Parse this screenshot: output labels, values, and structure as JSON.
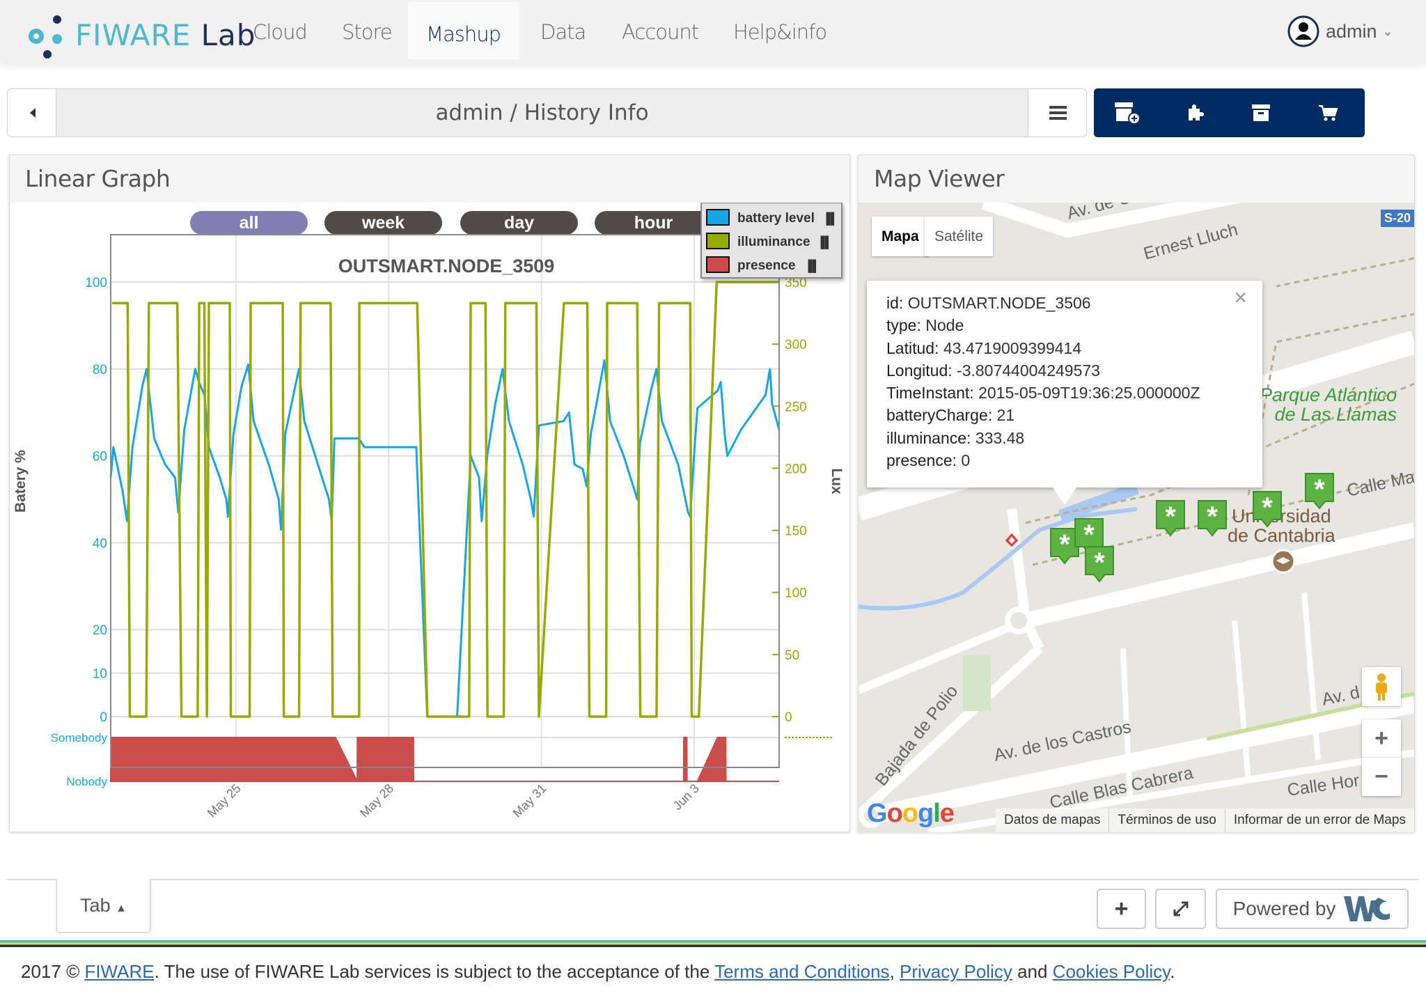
{
  "header": {
    "logo_text_1": "FIWARE",
    "logo_text_2": "Lab",
    "nav": [
      {
        "label": "Cloud"
      },
      {
        "label": "Store"
      },
      {
        "label": "Mashup",
        "active": true
      },
      {
        "label": "Data"
      },
      {
        "label": "Account"
      },
      {
        "label": "Help&info"
      }
    ],
    "user": "admin"
  },
  "breadcrumb": {
    "text": "admin / History Info"
  },
  "toolbar": {
    "icons": [
      "add-workspace-icon",
      "puzzle-icon",
      "archive-icon",
      "cart-icon"
    ],
    "color": "#002a62"
  },
  "graph_panel": {
    "title": "Linear Graph",
    "ranges": [
      {
        "label": "all",
        "selected": true
      },
      {
        "label": "week"
      },
      {
        "label": "day"
      },
      {
        "label": "hour"
      }
    ]
  },
  "chart_data": {
    "type": "line",
    "title": "OUTSMART.NODE_3509",
    "xlabel": "",
    "x_range": [
      "May 22 13:00",
      "Jun 4 16:00"
    ],
    "x_ticks": [
      "May 25",
      "May 28",
      "May 31",
      "Jun 3"
    ],
    "y_left": {
      "label": "Batery %",
      "range": [
        0,
        100
      ],
      "ticks": [
        0,
        10,
        20,
        40,
        60,
        80,
        100
      ]
    },
    "y_right": {
      "label": "Lux",
      "range": [
        0,
        350
      ],
      "ticks": [
        0,
        50,
        100,
        150,
        200,
        250,
        300,
        350
      ]
    },
    "presence_axis": {
      "ticks": [
        "Somebody",
        "Nobody"
      ]
    },
    "grid": true,
    "legend": "top-right",
    "series": [
      {
        "name": "battery level",
        "color": "#18a5e6",
        "axis": "left",
        "points": [
          [
            "May 22 13:00",
            55
          ],
          [
            "May 22 14:15",
            62
          ],
          [
            "May 22 18:35",
            52
          ],
          [
            "May 22 20:40",
            45
          ],
          [
            "May 22 23:15",
            62
          ],
          [
            "May 23 03:55",
            76
          ],
          [
            "May 23 05:55",
            80
          ],
          [
            "May 23 09:30",
            64
          ],
          [
            "May 23 14:40",
            58
          ],
          [
            "May 23 19:20",
            55
          ],
          [
            "May 23 20:50",
            47
          ],
          [
            "May 23 23:40",
            66
          ],
          [
            "May 24 04:50",
            80
          ],
          [
            "May 24 06:35",
            77
          ],
          [
            "May 24 09:10",
            74
          ],
          [
            "May 24 11:15",
            62
          ],
          [
            "May 24 16:25",
            55
          ],
          [
            "May 24 19:30",
            50
          ],
          [
            "May 24 20:15",
            46
          ],
          [
            "May 24 22:50",
            65
          ],
          [
            "May 25 02:40",
            76
          ],
          [
            "May 25 05:50",
            81
          ],
          [
            "May 25 08:20",
            68
          ],
          [
            "May 25 15:30",
            58
          ],
          [
            "May 25 20:10",
            50
          ],
          [
            "May 25 21:15",
            43
          ],
          [
            "May 25 23:15",
            65
          ],
          [
            "May 26 05:40",
            80
          ],
          [
            "May 26 08:15",
            68
          ],
          [
            "May 26 14:40",
            58
          ],
          [
            "May 26 19:50",
            50
          ],
          [
            "May 26 21:10",
            45
          ],
          [
            "May 26 22:25",
            64
          ],
          [
            "May 27 10:00",
            64
          ],
          [
            "May 27 11:15",
            63
          ],
          [
            "May 27 12:35",
            62
          ],
          [
            "May 28 13:00",
            62
          ],
          [
            "May 28 18:10",
            0
          ],
          [
            "May 29 08:15",
            0
          ],
          [
            "May 29 14:40",
            60
          ],
          [
            "May 29 18:35",
            55
          ],
          [
            "May 29 19:50",
            45
          ],
          [
            "May 29 22:25",
            60
          ],
          [
            "May 30 02:15",
            72
          ],
          [
            "May 30 05:40",
            80
          ],
          [
            "May 30 08:40",
            68
          ],
          [
            "May 30 15:10",
            58
          ],
          [
            "May 30 19:00",
            50
          ],
          [
            "May 30 20:20",
            46
          ],
          [
            "May 30 22:50",
            67
          ],
          [
            "May 31 10:25",
            68
          ],
          [
            "May 31 13:00",
            70
          ],
          [
            "May 31 15:35",
            58
          ],
          [
            "May 31 19:25",
            57
          ],
          [
            "May 31 21:15",
            53
          ],
          [
            "May 31 23:15",
            65
          ],
          [
            "Jun 1 05:40",
            82
          ],
          [
            "Jun 1 08:20",
            68
          ],
          [
            "Jun 1 14:45",
            60
          ],
          [
            "Jun 1 21:10",
            50
          ],
          [
            "Jun 1 22:25",
            63
          ],
          [
            "Jun 2 03:35",
            75
          ],
          [
            "Jun 2 06:10",
            80
          ],
          [
            "Jun 2 08:45",
            68
          ],
          [
            "Jun 2 16:25",
            58
          ],
          [
            "Jun 2 21:05",
            47
          ],
          [
            "Jun 2 22:05",
            46
          ],
          [
            "Jun 3 00:10",
            62
          ],
          [
            "Jun 3 01:30",
            71
          ],
          [
            "Jun 3 11:00",
            75
          ],
          [
            "Jun 3 12:30",
            77
          ],
          [
            "Jun 3 14:20",
            65
          ],
          [
            "Jun 3 15:35",
            60
          ],
          [
            "Jun 3 22:00",
            66
          ],
          [
            "Jun 4 09:35",
            74
          ],
          [
            "Jun 4 11:40",
            80
          ],
          [
            "Jun 4 12:40",
            72
          ],
          [
            "Jun 4 16:00",
            66
          ]
        ]
      },
      {
        "name": "illuminance",
        "color": "#98aa00",
        "axis": "right",
        "points": [
          [
            "May 22 13:40",
            333
          ],
          [
            "May 22 21:00",
            333
          ],
          [
            "May 22 22:00",
            0
          ],
          [
            "May 23 05:45",
            0
          ],
          [
            "May 23 07:00",
            333
          ],
          [
            "May 23 20:24",
            333
          ],
          [
            "May 23 22:20",
            0
          ],
          [
            "May 24 06:00",
            0
          ],
          [
            "May 24 06:43",
            333
          ],
          [
            "May 24 09:07",
            333
          ],
          [
            "May 24 10:19",
            0
          ],
          [
            "May 24 11:17",
            333
          ],
          [
            "May 24 21:07",
            333
          ],
          [
            "May 24 21:36",
            0
          ],
          [
            "May 25 06:29",
            0
          ],
          [
            "May 25 06:58",
            333
          ],
          [
            "May 25 22:05",
            333
          ],
          [
            "May 25 22:34",
            0
          ],
          [
            "May 26 05:46",
            0
          ],
          [
            "May 26 06:29",
            333
          ],
          [
            "May 26 20:38",
            333
          ],
          [
            "May 26 21:36",
            0
          ],
          [
            "May 27 10:05",
            0
          ],
          [
            "May 27 10:10",
            333
          ],
          [
            "May 28 13:26",
            333
          ],
          [
            "May 28 18:14",
            0
          ],
          [
            "May 29 13:55",
            0
          ],
          [
            "May 29 14:38",
            333
          ],
          [
            "May 29 21:36",
            333
          ],
          [
            "May 29 22:34",
            0
          ],
          [
            "May 30 06:14",
            0
          ],
          [
            "May 30 06:58",
            333
          ],
          [
            "May 30 21:36",
            333
          ],
          [
            "May 30 22:48",
            0
          ],
          [
            "May 31 10:34",
            333
          ],
          [
            "May 31 21:36",
            333
          ],
          [
            "May 31 22:34",
            0
          ],
          [
            "Jun 1 06:29",
            0
          ],
          [
            "Jun 1 06:58",
            333
          ],
          [
            "Jun 1 21:07",
            333
          ],
          [
            "Jun 1 22:34",
            0
          ],
          [
            "Jun 2 06:14",
            0
          ],
          [
            "Jun 2 07:26",
            333
          ],
          [
            "Jun 2 22:05",
            333
          ],
          [
            "Jun 2 22:48",
            0
          ],
          [
            "Jun 3 02:10",
            0
          ],
          [
            "Jun 3 10:34",
            350
          ],
          [
            "Jun 4 16:00",
            350
          ]
        ]
      },
      {
        "name": "presence",
        "color": "#cc4b4b",
        "axis": "presence",
        "points": [
          [
            "May 22 13:00",
            1
          ],
          [
            "May 26 22:55",
            1
          ],
          [
            "May 27 09:10",
            0
          ],
          [
            "May 27 09:15",
            1
          ],
          [
            "May 28 11:40",
            1
          ],
          [
            "May 28 11:45",
            0
          ],
          [
            "Jun 2 19:00",
            0
          ],
          [
            "Jun 2 19:05",
            1
          ],
          [
            "Jun 2 20:30",
            1
          ],
          [
            "Jun 2 20:35",
            0
          ],
          [
            "Jun 3 01:30",
            0
          ],
          [
            "Jun 3 11:00",
            1
          ],
          [
            "Jun 3 14:50",
            1
          ],
          [
            "Jun 3 14:55",
            0
          ],
          [
            "Jun 4 16:00",
            0
          ]
        ]
      }
    ]
  },
  "map_panel": {
    "title": "Map Viewer",
    "map_type": {
      "map": "Mapa",
      "satellite": "Satélite"
    },
    "popup": {
      "rows": [
        {
          "k": "id:",
          "v": "OUTSMART.NODE_3506"
        },
        {
          "k": "type:",
          "v": "Node"
        },
        {
          "k": "Latitud:",
          "v": "43.4719009399414"
        },
        {
          "k": "Longitud:",
          "v": "-3.80744004249573"
        },
        {
          "k": "TimeInstant:",
          "v": "2015-05-09T19:36:25.000000Z"
        },
        {
          "k": "batteryCharge:",
          "v": "21"
        },
        {
          "k": "illuminance:",
          "v": "333.48"
        },
        {
          "k": "presence:",
          "v": "0"
        }
      ],
      "close": "×"
    },
    "labels": {
      "av_cantabria": "Av. de Canta",
      "ernest_lluch": "Ernest Lluch",
      "s20": "S-20",
      "park_1": "Parque Atlántico",
      "park_2": "de Las Llamas",
      "calle_ma": "Calle Ma",
      "uni_1": "Universidad",
      "uni_2": "de Cantabria",
      "bajada": "Bajada de Polio",
      "castros": "Av. de los Castros",
      "blas": "Calle Blas Cabrera",
      "avd": "Av. d",
      "calle_hor": "Calle Hor"
    },
    "google": "Google",
    "attrib": [
      "Datos de mapas",
      "Términos de uso",
      "Informar de un error de Maps"
    ],
    "zoom_in": "+",
    "zoom_out": "−",
    "marker_color": "#5db341"
  },
  "bottom": {
    "tab": "Tab",
    "add": "+",
    "powered": "Powered by"
  },
  "footer": {
    "pre": "2017 © ",
    "fiware": "FIWARE",
    "mid": ". The use of FIWARE Lab services is subject to the acceptance of the ",
    "terms": "Terms and Conditions",
    "comma": ", ",
    "privacy": "Privacy Policy",
    "and": " and ",
    "cookies": "Cookies Policy",
    "end": "."
  }
}
